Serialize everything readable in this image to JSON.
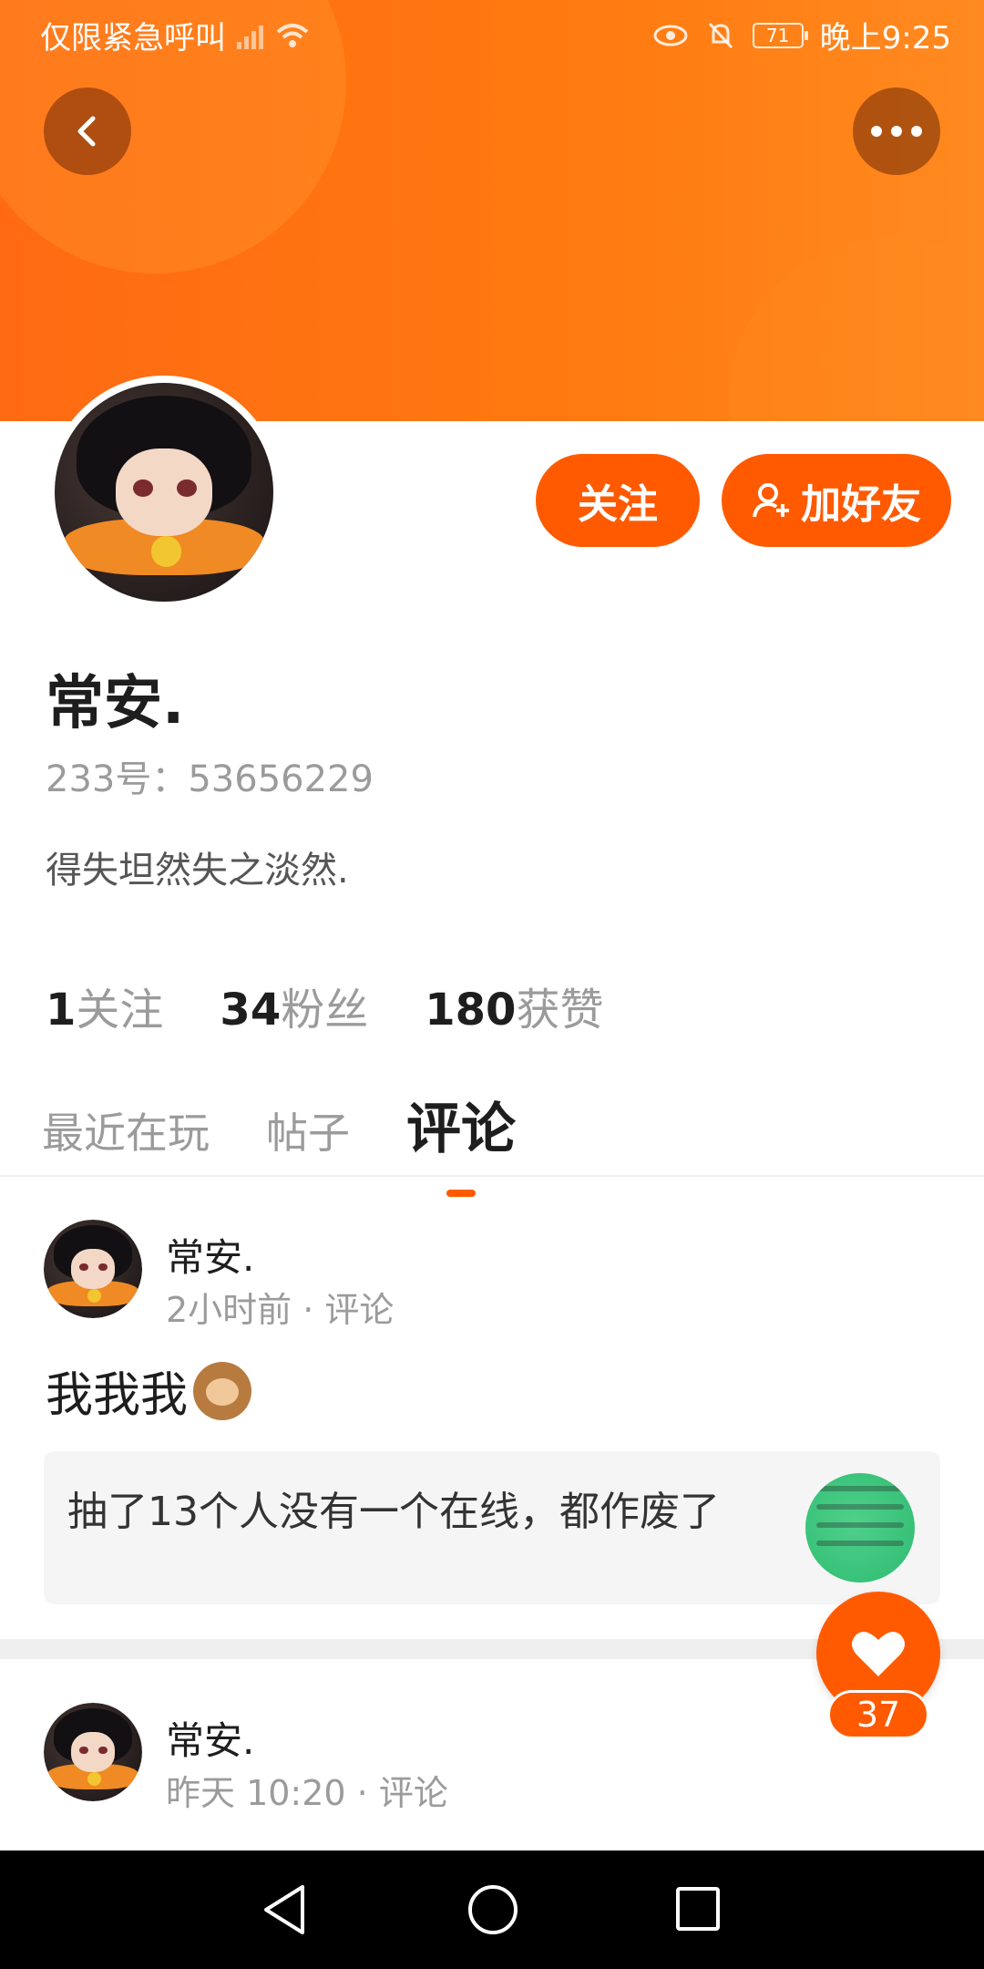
{
  "status_bar": {
    "carrier_text": "仅限紧急呼叫",
    "battery": "71",
    "time": "晚上9:25"
  },
  "colors": {
    "accent": "#ff5a00",
    "banner": "#ff6a13"
  },
  "profile": {
    "name": "常安.",
    "id_text": "233号：53656229",
    "bio": "得失坦然失之淡然."
  },
  "actions": {
    "follow_label": "关注",
    "add_friend_label": "加好友"
  },
  "stats": [
    {
      "value": "1",
      "label": "关注"
    },
    {
      "value": "34",
      "label": "粉丝"
    },
    {
      "value": "180",
      "label": "获赞"
    }
  ],
  "tabs": [
    {
      "label": "最近在玩",
      "active": false
    },
    {
      "label": "帖子",
      "active": false
    },
    {
      "label": "评论",
      "active": true
    }
  ],
  "posts": [
    {
      "author": "常安.",
      "meta": "2小时前 · 评论",
      "text": "我我我",
      "quote": "抽了13个人没有一个在线，都作废了"
    },
    {
      "author": "常安.",
      "meta": "昨天 10:20 · 评论"
    }
  ],
  "like": {
    "count": "37"
  },
  "icons": [
    "back-icon",
    "more-icon",
    "eye-icon",
    "bell-off-icon",
    "wifi-icon",
    "signal-icon",
    "battery-icon",
    "add-user-icon",
    "heart-icon",
    "nav-back-icon",
    "nav-home-icon",
    "nav-recent-icon"
  ]
}
